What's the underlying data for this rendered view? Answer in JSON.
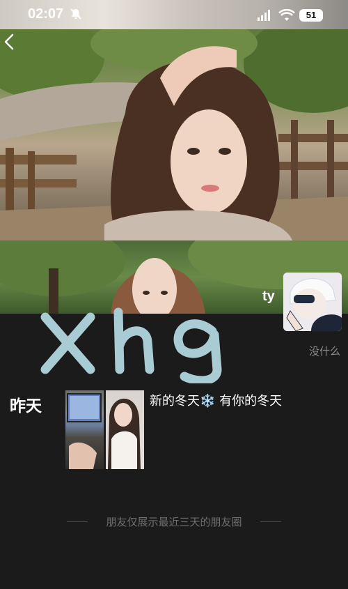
{
  "status_bar": {
    "time": "02:07",
    "battery": "51",
    "icons": [
      "mute-bell-icon",
      "signal-icon",
      "wifi-icon",
      "battery-icon"
    ]
  },
  "header": {
    "back_icon": "chevron-left-icon"
  },
  "profile": {
    "handwriting": "xhg",
    "nickname": "ty",
    "signature": "没什么"
  },
  "posts": [
    {
      "date": "昨天",
      "text_before": "新的冬天",
      "emoji": "❄️",
      "text_after": "有你的冬天"
    }
  ],
  "footer": {
    "note": "朋友仅展示最近三天的朋友圈"
  },
  "colors": {
    "background": "#1b1b1b",
    "handwriting": "#a9cbd3",
    "muted_text": "#8d8d8d"
  }
}
